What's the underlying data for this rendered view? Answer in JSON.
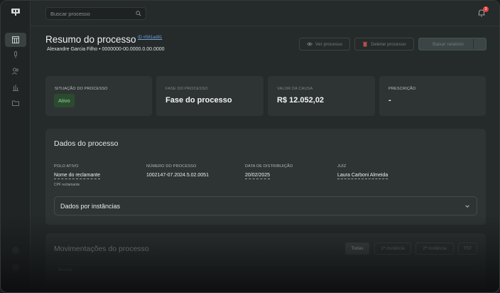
{
  "topbar": {
    "search_placeholder": "Buscar processo",
    "notification_count": "3"
  },
  "header": {
    "title": "Resumo do processo",
    "id": "ID #581ad81",
    "subtitle": "Alexandre Garcia Filho • 0000000-00.0000.0.00.0000",
    "view_label": "Ver processo",
    "delete_label": "Deletar processo",
    "report_label": "Baixar relatório"
  },
  "summary": [
    {
      "label": "SITUAÇÃO DO PROCESSO",
      "value": "Ativo"
    },
    {
      "label": "FASE DO PROCESSO",
      "value": "Fase do processo"
    },
    {
      "label": "VALOR DA CAUSA",
      "value": "R$ 12.052,02"
    },
    {
      "label": "PRESCRIÇÃO",
      "value": "-"
    }
  ],
  "dados": {
    "title": "Dados do processo",
    "fields": [
      {
        "label": "POLO ATIVO",
        "value": "Nome do reclamante",
        "note": "CPF reclamante"
      },
      {
        "label": "NÚMERO DO PROCESSO",
        "value": "1002147-07.2024.5.02.0051"
      },
      {
        "label": "DATA DE DISTRIBUIÇÃO",
        "value": "20/02/2025"
      },
      {
        "label": "JUÍZ",
        "value": "Laura Carboni Almeida"
      }
    ],
    "instancias_label": "Dados por instâncias"
  },
  "movimentacoes": {
    "title": "Movimentações do processo",
    "filters": [
      "Todas",
      "1ª instância",
      "2ª instância",
      "TST"
    ],
    "search_placeholder": "Buscar"
  },
  "colors": {
    "accent_status": "#7ee08a",
    "notification": "#e0453f",
    "link": "#6e9fd6"
  }
}
